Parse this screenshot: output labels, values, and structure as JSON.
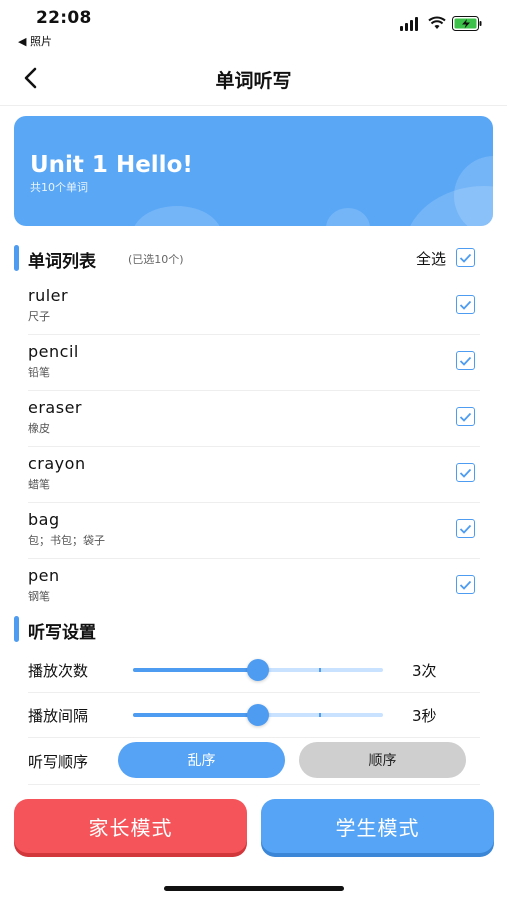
{
  "status_bar": {
    "time": "22:08",
    "back_app": "◀ 照片"
  },
  "nav": {
    "title": "单词听写"
  },
  "banner": {
    "title": "Unit 1 Hello!",
    "subtitle": "共10个单词"
  },
  "word_section": {
    "title": "单词列表",
    "selected_count": "(已选10个)",
    "select_all_label": "全选",
    "words": [
      {
        "en": "ruler",
        "cn": "尺子",
        "checked": true
      },
      {
        "en": "pencil",
        "cn": "铅笔",
        "checked": true
      },
      {
        "en": "eraser",
        "cn": "橡皮",
        "checked": true
      },
      {
        "en": "crayon",
        "cn": "蜡笔",
        "checked": true
      },
      {
        "en": "bag",
        "cn": "包；书包；袋子",
        "checked": true
      },
      {
        "en": "pen",
        "cn": "钢笔",
        "checked": true
      }
    ]
  },
  "settings": {
    "title": "听写设置",
    "play_times": {
      "label": "播放次数",
      "value": "3次",
      "level": 0.5
    },
    "play_interval": {
      "label": "播放间隔",
      "value": "3秒",
      "level": 0.5
    },
    "order": {
      "label": "听写顺序",
      "options": [
        "乱序",
        "顺序"
      ],
      "selected": "乱序"
    }
  },
  "buttons": {
    "parent_mode": "家长模式",
    "student_mode": "学生模式"
  },
  "colors": {
    "primary": "#4e9cf2",
    "danger": "#f5555a",
    "banner": "#5aa7f6"
  }
}
